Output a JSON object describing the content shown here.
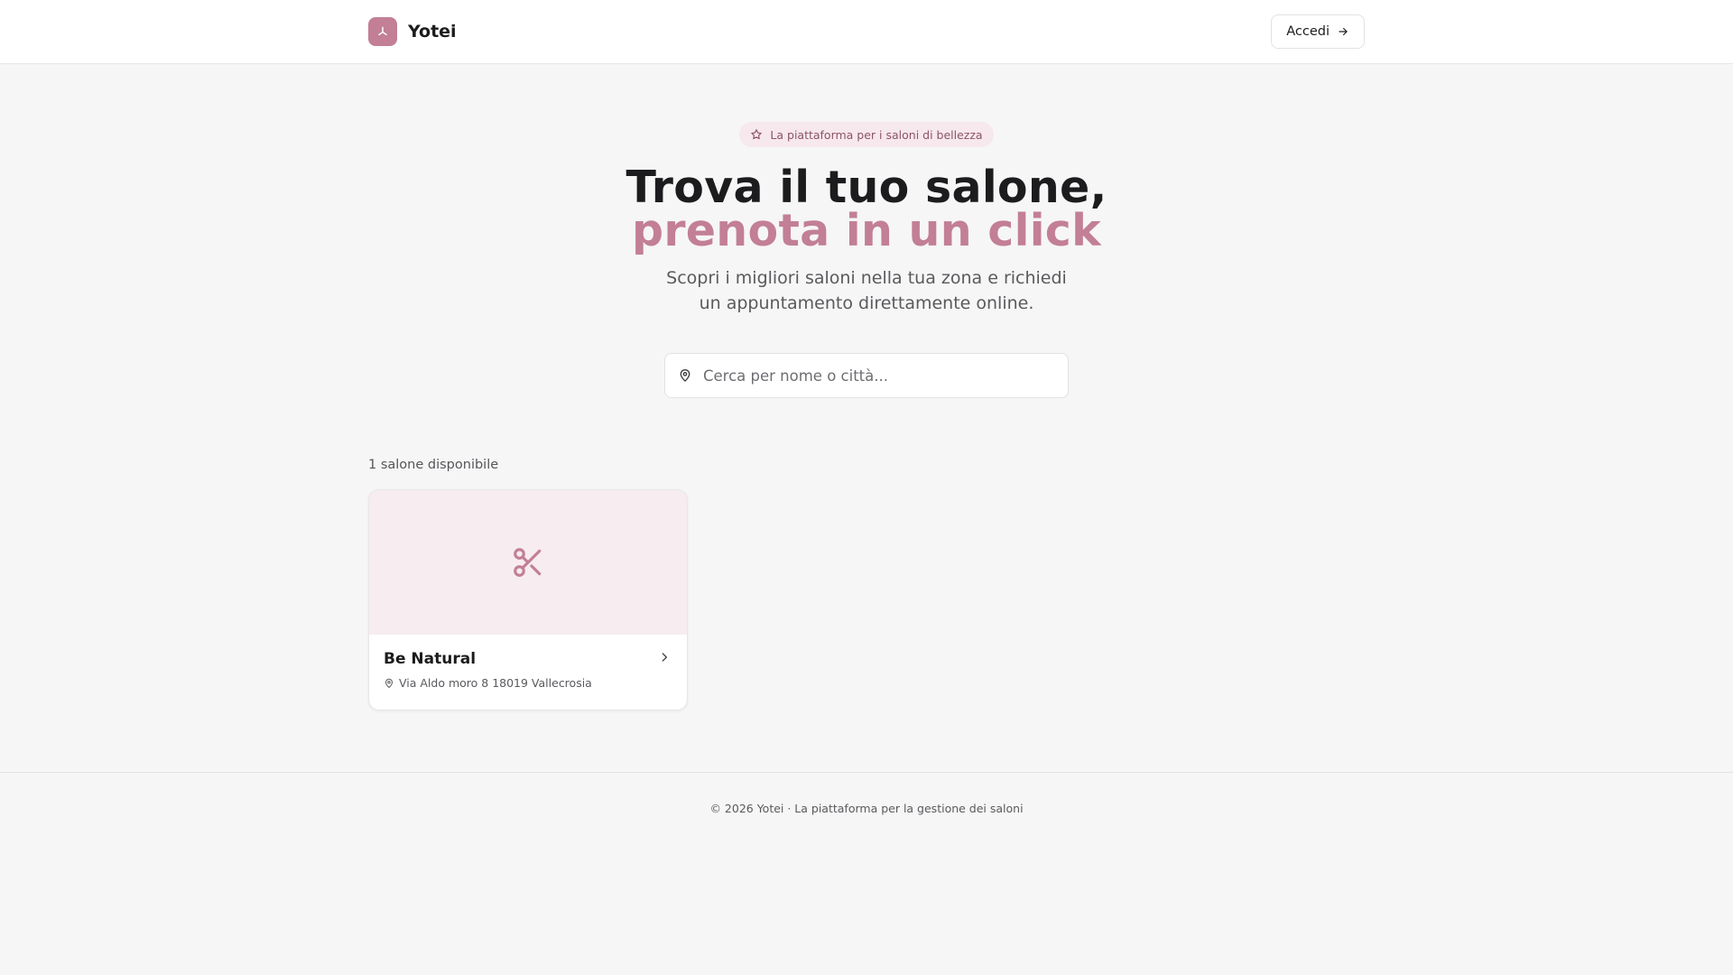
{
  "header": {
    "brand_name": "Yotei",
    "login_label": "Accedi"
  },
  "hero": {
    "badge_text": "La piattaforma per i saloni di bellezza",
    "title_line1": "Trova il tuo salone,",
    "title_line2": "prenota in un click",
    "subtitle": "Scopri i migliori saloni nella tua zona e richiedi un appuntamento direttamente online."
  },
  "search": {
    "placeholder": "Cerca per nome o città...",
    "value": ""
  },
  "results": {
    "count_text": "1 salone disponibile",
    "salons": [
      {
        "name": "Be Natural",
        "address": "Via Aldo moro 8 18019 Vallecrosia",
        "image_icon": "scissors-icon"
      }
    ]
  },
  "footer": {
    "text": "© 2026 Yotei · La piattaforma per la gestione dei saloni"
  },
  "colors": {
    "accent": "#c27f96",
    "badge_bg": "#f7e8ed",
    "card_media_bg": "#f7ecf0",
    "page_bg": "#f6f6f6"
  },
  "icons": {
    "logo": "umbrella-icon",
    "login": "arrow-right-icon",
    "badge": "star-icon",
    "search": "map-pin-icon",
    "card_chevron": "chevron-right-icon",
    "card_address": "map-pin-icon"
  }
}
